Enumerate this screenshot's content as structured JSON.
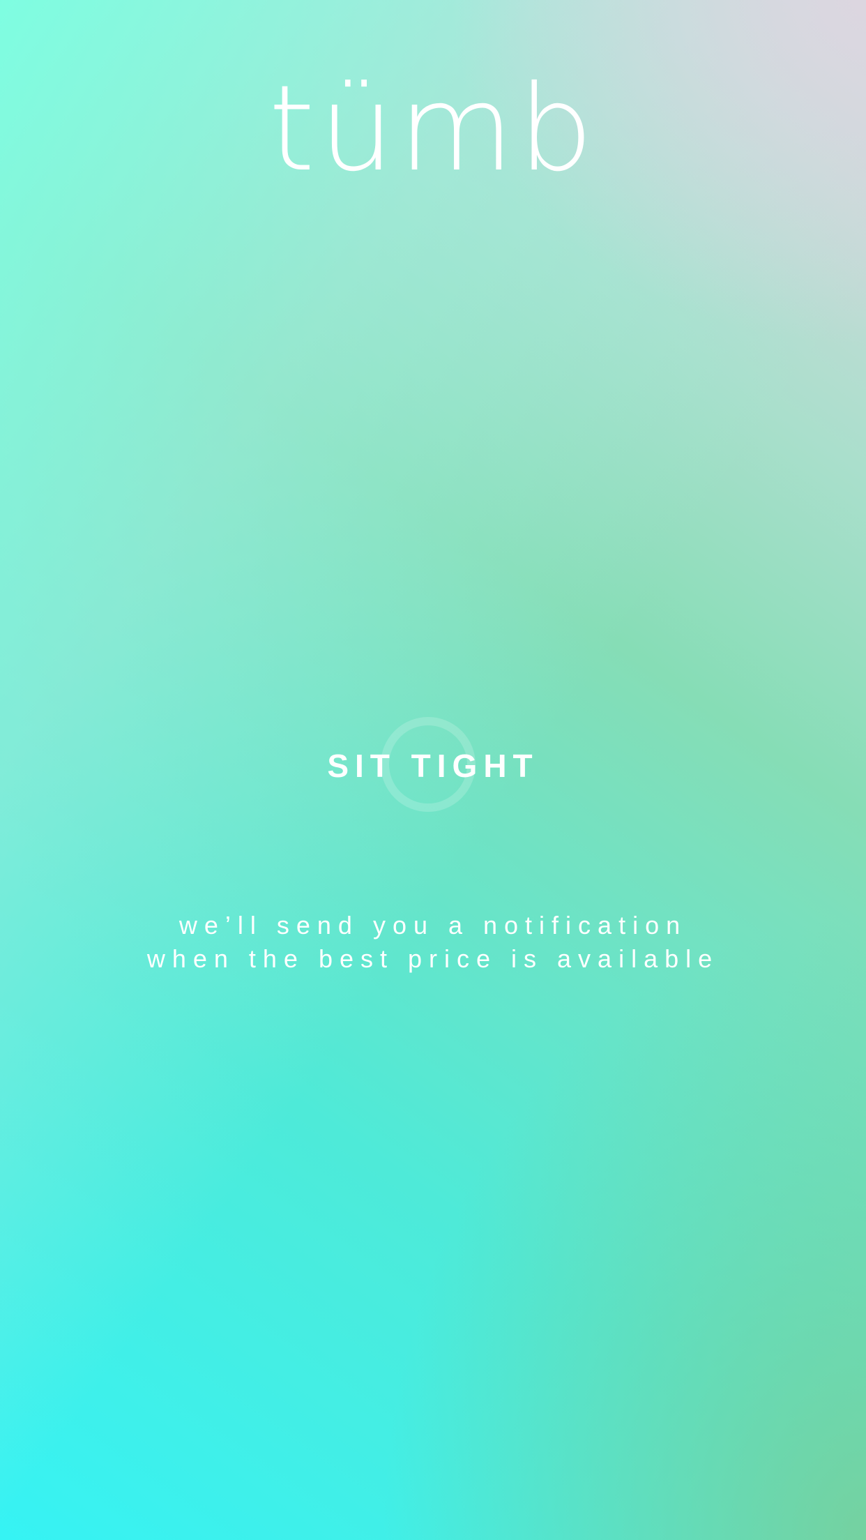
{
  "app": {
    "logo_text": "tümb"
  },
  "status": {
    "headline": "SIT TIGHT",
    "message_line_1": "we’ll send you a notification",
    "message_line_2": "when the best price is available"
  },
  "theme": {
    "gradient_colors": [
      "#7dffe3",
      "#36f3f4",
      "#7ccd96",
      "#ddd6e0"
    ],
    "text_color": "#ffffff"
  },
  "icons": {
    "spinner": "loading-spinner-icon"
  }
}
